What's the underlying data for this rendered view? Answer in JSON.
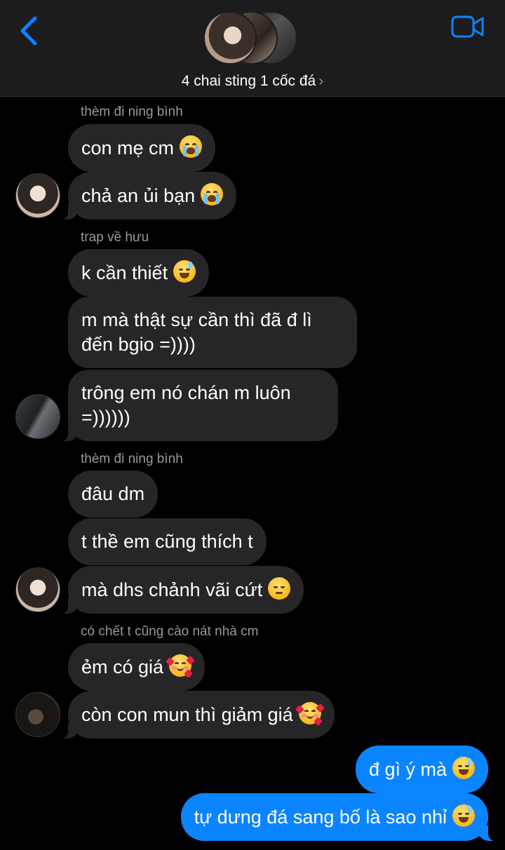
{
  "header": {
    "title": "4 chai sting 1 cốc đá",
    "chevron": "›",
    "back_icon": "chevron-left-icon",
    "video_icon": "video-camera-icon",
    "accent_color": "#0a84ff"
  },
  "messages": [
    {
      "sender": "thèm đi ning bình",
      "text": "con mẹ cm",
      "emoji": "loudly-crying-face"
    },
    {
      "text": "chả an ủi bạn",
      "emoji": "loudly-crying-face"
    },
    {
      "sender": "trap về hưu",
      "text": "k cần thiết",
      "emoji": "grinning-face-with-sweat"
    },
    {
      "text": "m mà thật sự cần thì đã đ lì đến bgio =))))"
    },
    {
      "text": "trông em nó chán m luôn =))))))"
    },
    {
      "sender": "thèm đi ning bình",
      "text": "đâu dm"
    },
    {
      "text": "t thề em cũng thích t"
    },
    {
      "text": "mà dhs chảnh vãi cứt",
      "emoji": "pensive-face"
    },
    {
      "sender": "có chết t cũng cào nát nhà cm",
      "text": "ẻm có giá",
      "emoji": "smiling-face-with-hearts"
    },
    {
      "text": "còn con mun thì giảm giá",
      "emoji": "smiling-face-with-hearts"
    },
    {
      "text": "đ gì ý mà",
      "emoji": "grinning-face-with-sweat",
      "outgoing": true
    },
    {
      "text": "tự dưng đá sang bố là sao nhỉ",
      "emoji": "grinning-face-with-sweat",
      "outgoing": true
    }
  ]
}
